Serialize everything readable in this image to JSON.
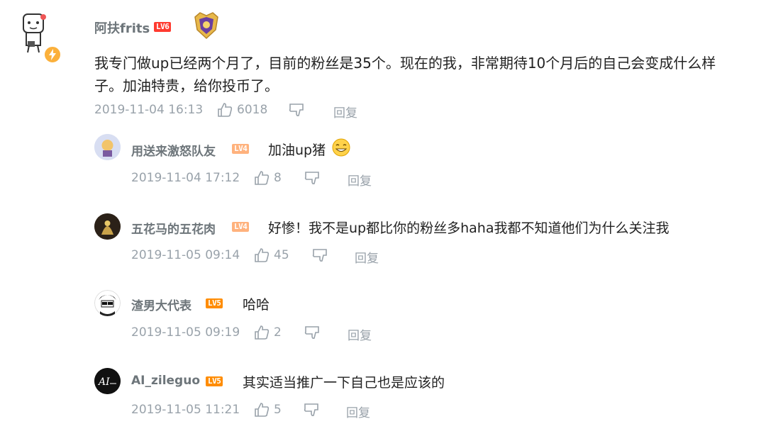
{
  "icons": {
    "like": "thumbs-up-icon",
    "dislike": "thumbs-down-icon",
    "verified": "lightning-badge-icon",
    "emoji": "grin-emoji-icon"
  },
  "main_comment": {
    "username": "阿扶frits",
    "level": "LV6",
    "text_line1": "我专门做up已经两个月了，目前的粉丝是35个。现在的我，非常期待10个月后的自己会变成什么样",
    "text_line2": "子。加油特贵，给你投币了。",
    "time": "2019-11-04 16:13",
    "likes": "6018",
    "reply_label": "回复"
  },
  "replies": [
    {
      "username": "用送来激怒队友",
      "level": "LV4",
      "text": "加油up猪",
      "time": "2019-11-04 17:12",
      "likes": "8",
      "reply_label": "回复"
    },
    {
      "username": "五花马的五花肉",
      "level": "LV4",
      "text": "好惨！我不是up都比你的粉丝多haha我都不知道他们为什么关注我",
      "time": "2019-11-05 09:14",
      "likes": "45",
      "reply_label": "回复"
    },
    {
      "username": "渣男大代表",
      "level": "LV5",
      "text": "哈哈",
      "time": "2019-11-05 09:19",
      "likes": "2",
      "reply_label": "回复"
    },
    {
      "username": "AI_zileguo",
      "level": "LV5",
      "text": "其实适当推广一下自己也是应该的",
      "time": "2019-11-05 11:21",
      "likes": "5",
      "reply_label": "回复"
    }
  ],
  "colors": {
    "username": "#6d757a",
    "meta": "#99a2aa",
    "lv6": "#ff3b30",
    "lv4": "#ffb27d",
    "lv5": "#ff8c00",
    "verified": "#fbb03b"
  }
}
